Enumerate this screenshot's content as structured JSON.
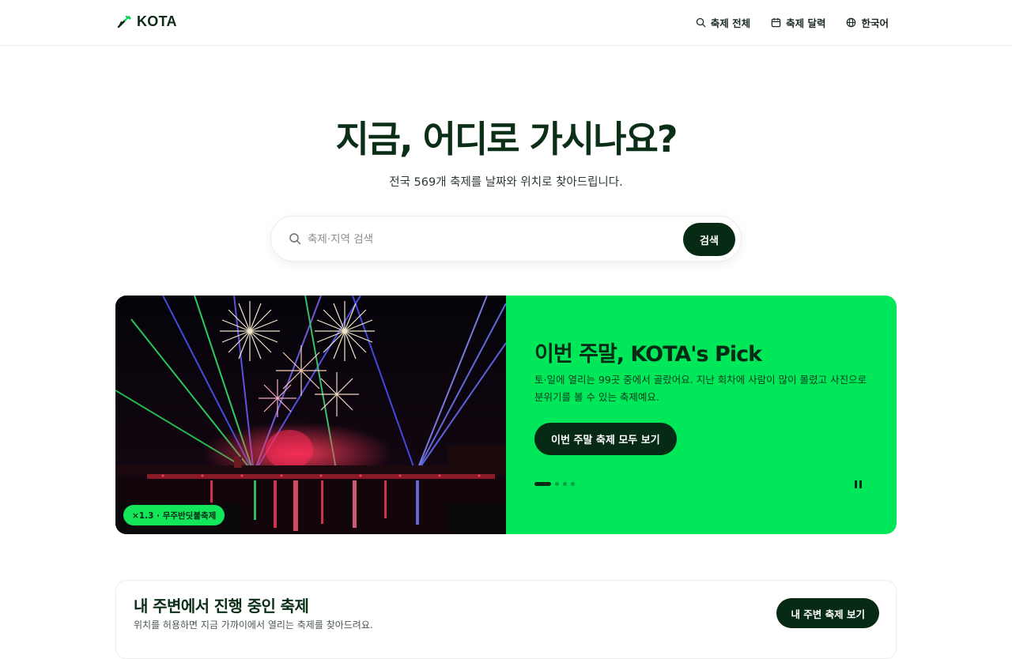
{
  "header": {
    "logo_text": "KOTA",
    "nav": [
      {
        "label": "축제 전체",
        "icon": "search-icon"
      },
      {
        "label": "축제 달력",
        "icon": "calendar-icon"
      },
      {
        "label": "한국어",
        "icon": "globe-icon"
      }
    ]
  },
  "hero": {
    "title": "지금, 어디로 가시나요?",
    "subtitle": "전국 569개 축제를 날짜와 위치로 찾아드립니다."
  },
  "search": {
    "placeholder": "축제·지역 검색",
    "value": "",
    "button_label": "검색"
  },
  "feature": {
    "image_tag": "×1.3 · 무주반딧불축제",
    "title": "이번 주말, KOTA's Pick",
    "description": "토·일에 열리는 99곳 중에서 골랐어요. 지난 회차에 사람이 많이 몰렸고 사진으로 분위기를 볼 수 있는 축제예요.",
    "button_label": "이번 주말 축제 모두 보기",
    "slides_total": 4,
    "slide_active": 1,
    "colors": {
      "panel": "#00e85a",
      "button": "#062a14"
    }
  },
  "nearby": {
    "title": "내 주변에서 진행 중인 축제",
    "description": "위치를 허용하면 지금 가까이에서 열리는 축제를 찾아드려요.",
    "button_label": "내 주변 축제 보기"
  }
}
